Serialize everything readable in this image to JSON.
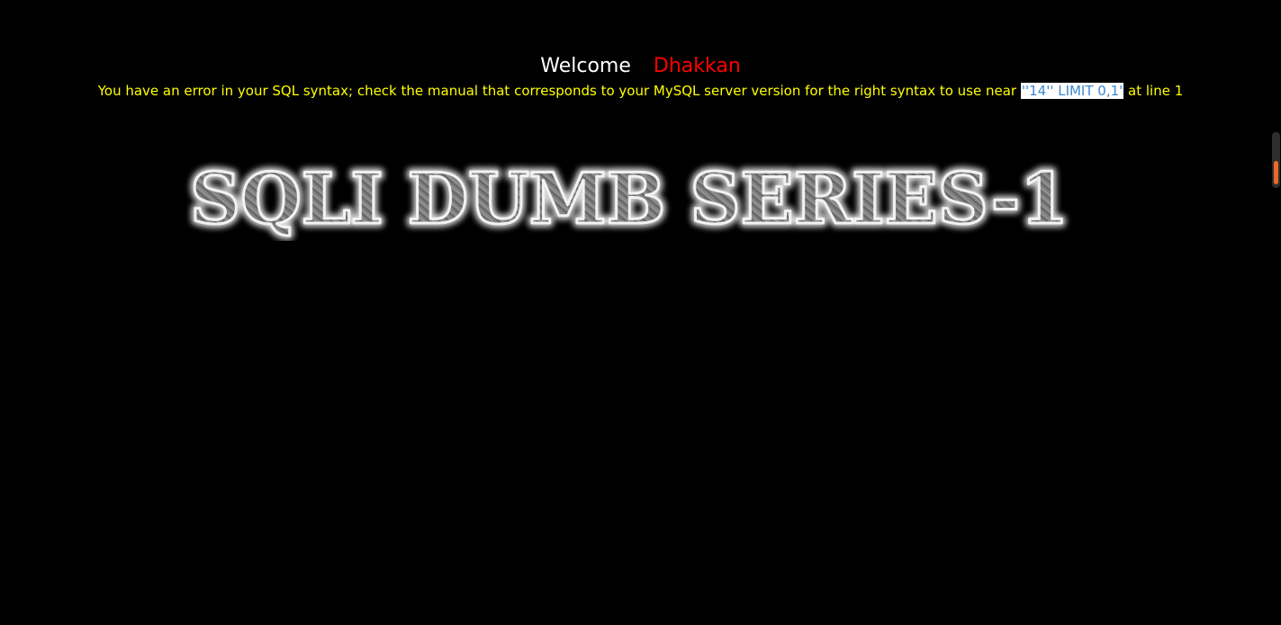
{
  "welcome": {
    "greeting": "Welcome",
    "username": "Dhakkan"
  },
  "error": {
    "prefix": "You have an error in your SQL syntax; check the manual that corresponds to your MySQL server version for the right syntax to use near ",
    "highlight": "''14'' LIMIT 0,1'",
    "suffix": " at line 1"
  },
  "banner": {
    "title": "SQLI DUMB SERIES-1"
  },
  "colors": {
    "background": "#000000",
    "greeting": "#ffffff",
    "username": "#ff0000",
    "error_text": "#ffff00",
    "highlight_text": "#3d86d1",
    "scroll_thumb": "#e96a26"
  }
}
